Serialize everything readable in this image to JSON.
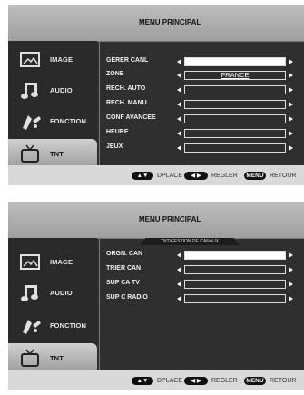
{
  "panel1": {
    "title": "MENU PRINCIPAL",
    "sidebar": [
      {
        "label": "IMAGE",
        "icon": "picture-icon"
      },
      {
        "label": "AUDIO",
        "icon": "music-note-icon"
      },
      {
        "label": "FONCTION",
        "icon": "function-tools-icon"
      },
      {
        "label": "TNT",
        "icon": "tv-icon",
        "active": true
      }
    ],
    "rows": [
      {
        "label": "GERER CANL",
        "value": "",
        "selected": true
      },
      {
        "label": "ZONE",
        "value": "FRANCE"
      },
      {
        "label": "RECH. AUTO",
        "value": ""
      },
      {
        "label": "RECH. MANU.",
        "value": ""
      },
      {
        "label": "CONF AVANCEE",
        "value": ""
      },
      {
        "label": "HEURE",
        "value": ""
      },
      {
        "label": "JEUX",
        "value": ""
      }
    ],
    "footer": {
      "move_label": "DPLACE",
      "adjust_label": "REGLER",
      "menu_key": "MENU",
      "back_label": "RETOUR"
    }
  },
  "panel2": {
    "title": "MENU PRINCIPAL",
    "subtitle": "TNT\\GESTION DE CANAUX",
    "sidebar": [
      {
        "label": "IMAGE",
        "icon": "picture-icon"
      },
      {
        "label": "AUDIO",
        "icon": "music-note-icon"
      },
      {
        "label": "FONCTION",
        "icon": "function-tools-icon"
      },
      {
        "label": "TNT",
        "icon": "tv-icon",
        "active": true
      }
    ],
    "rows": [
      {
        "label": "ORGN. CAN",
        "value": "",
        "selected": true
      },
      {
        "label": "TRIER CAN",
        "value": ""
      },
      {
        "label": "SUP CA TV",
        "value": ""
      },
      {
        "label": "SUP C RADIO",
        "value": ""
      }
    ],
    "footer": {
      "move_label": "DPLACE",
      "adjust_label": "REGLER",
      "menu_key": "MENU",
      "back_label": "RETOUR"
    }
  }
}
